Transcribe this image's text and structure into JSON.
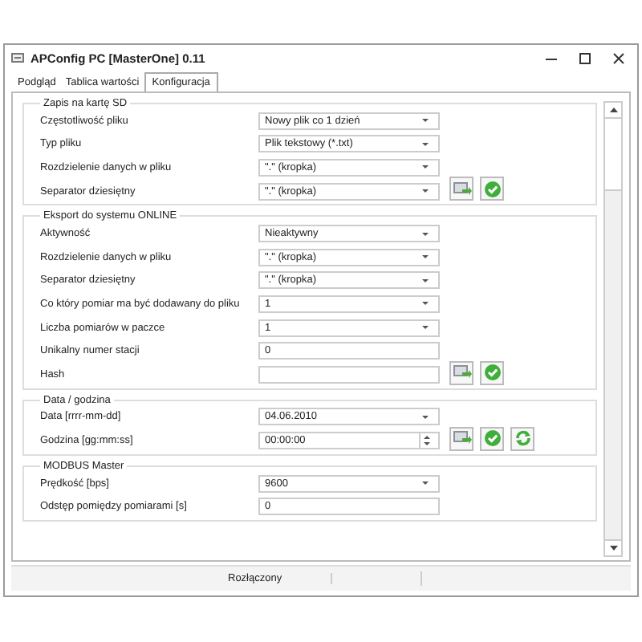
{
  "window": {
    "title": "APConfig PC [MasterOne] 0.11"
  },
  "tabs": [
    {
      "label": "Podgląd",
      "selected": false
    },
    {
      "label": "Tablica wartości",
      "selected": false
    },
    {
      "label": "Konfiguracja",
      "selected": true
    }
  ],
  "groups": [
    {
      "title": "Zapis na kartę SD",
      "rows": [
        {
          "label": "Częstotliwość pliku",
          "kind": "dropdown",
          "value": "Nowy plik co 1 dzień"
        },
        {
          "label": "Typ pliku",
          "kind": "dropdown",
          "value": "Plik tekstowy (*.txt)"
        },
        {
          "label": "Rozdzielenie danych w pliku",
          "kind": "dropdown",
          "value": "\".\" (kropka)"
        },
        {
          "label": "Separator dziesiętny",
          "kind": "dropdown",
          "value": "\".\" (kropka)"
        }
      ],
      "actions": [
        {
          "kind": "send"
        },
        {
          "kind": "confirm"
        }
      ]
    },
    {
      "title": "Eksport do systemu ONLINE",
      "rows": [
        {
          "label": "Aktywność",
          "kind": "dropdown",
          "value": "Nieaktywny"
        },
        {
          "label": "Rozdzielenie danych w pliku",
          "kind": "dropdown",
          "value": "\".\" (kropka)"
        },
        {
          "label": "Separator dziesiętny",
          "kind": "dropdown",
          "value": "\".\" (kropka)"
        },
        {
          "label": "Co który pomiar ma być dodawany do pliku",
          "kind": "dropdown",
          "value": "1"
        },
        {
          "label": "Liczba pomiarów w paczce",
          "kind": "dropdown",
          "value": "1"
        },
        {
          "label": "Unikalny numer stacji",
          "kind": "text",
          "value": "0"
        },
        {
          "label": "Hash",
          "kind": "text"
        }
      ],
      "actions": [
        {
          "kind": "send"
        },
        {
          "kind": "confirm"
        }
      ]
    },
    {
      "title": "Data / godzina",
      "rows": [
        {
          "label": "Data [rrrr-mm-dd]",
          "kind": "dropdown",
          "value": "04.06.2010"
        },
        {
          "label": "Godzina [gg:mm:ss]",
          "kind": "spin",
          "value": "00:00:00"
        }
      ],
      "actions": [
        {
          "kind": "send"
        },
        {
          "kind": "confirm"
        },
        {
          "kind": "refresh"
        }
      ]
    },
    {
      "title": "MODBUS Master",
      "rows": [
        {
          "label": "Prędkość [bps]",
          "kind": "dropdown",
          "value": "9600"
        },
        {
          "label": "Odstęp pomiędzy pomiarami [s]",
          "kind": "text",
          "value": "0"
        }
      ]
    }
  ],
  "status_bar": {
    "text": "Rozłączony"
  }
}
